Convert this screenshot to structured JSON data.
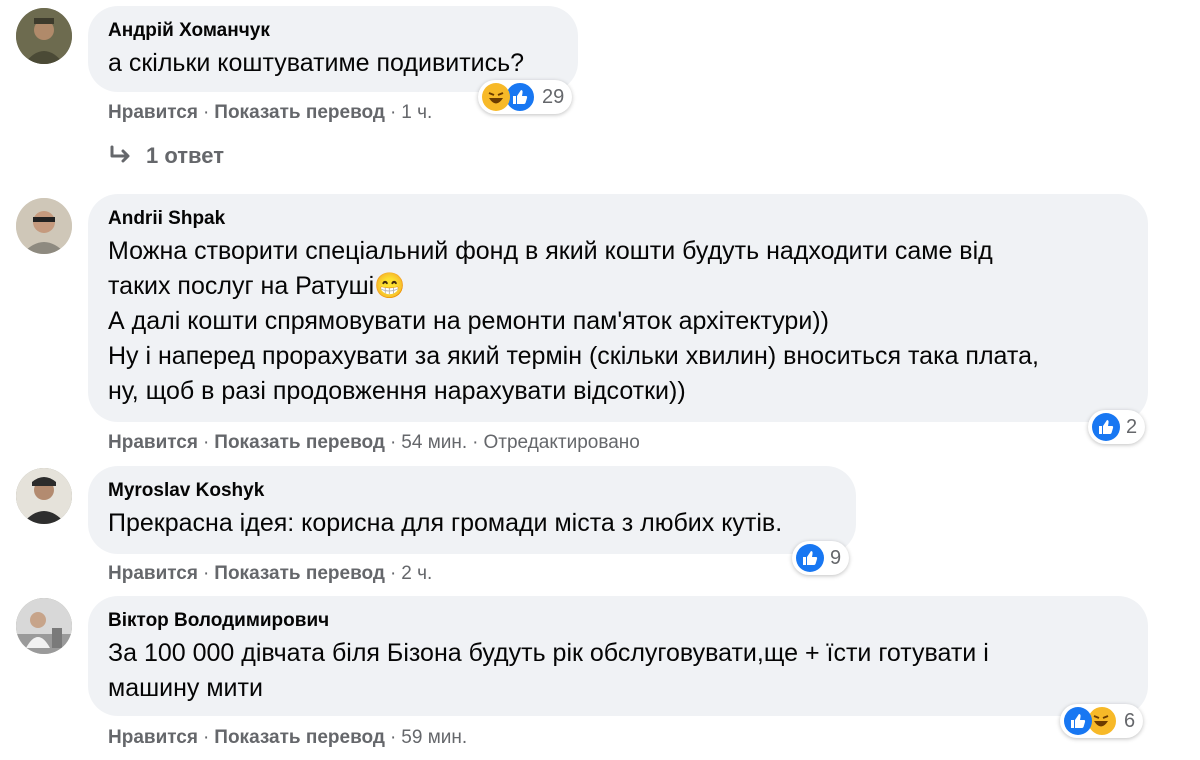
{
  "comments": [
    {
      "author": "Андрій Хоманчук",
      "lines": "а скільки коштуватиме подивитись?",
      "like": "Нравится",
      "translate": "Показать перевод",
      "time": "1 ч.",
      "edited": "",
      "reactions": [
        "haha",
        "like"
      ],
      "reaction_count": "29",
      "replies_label": "1 ответ"
    },
    {
      "author": "Andrii Shpak",
      "lines": "Можна створити спеціальний фонд в який кошти будуть надходити саме від\nтаких послуг на Ратуші😁\nА далі кошти спрямовувати на ремонти пам'яток архітектури))\nНу і наперед прорахувати за який термін (скільки хвилин) вноситься така плата,\nну, щоб в разі продовження нарахувати відсотки))",
      "like": "Нравится",
      "translate": "Показать перевод",
      "time": "54 мин.",
      "edited": "Отредактировано",
      "reactions": [
        "like"
      ],
      "reaction_count": "2"
    },
    {
      "author": "Myroslav Koshyk",
      "lines": "Прекрасна ідея: корисна для громади міста з любих кутів.",
      "like": "Нравится",
      "translate": "Показать перевод",
      "time": "2 ч.",
      "edited": "",
      "reactions": [
        "like"
      ],
      "reaction_count": "9"
    },
    {
      "author": "Віктор Володимирович",
      "lines": "За 100 000 дівчата біля Бізона будуть рік обслуговувати,ще + їсти готувати і\nмашину мити",
      "like": "Нравится",
      "translate": "Показать перевод",
      "time": "59 мин.",
      "edited": "",
      "reactions": [
        "like",
        "haha"
      ],
      "reaction_count": "6"
    }
  ],
  "separator": "·",
  "colors": {
    "bubble": "#f0f2f5",
    "meta": "#65676b",
    "like_blue": "#1877f2",
    "haha_yellow": "#f7b928"
  }
}
